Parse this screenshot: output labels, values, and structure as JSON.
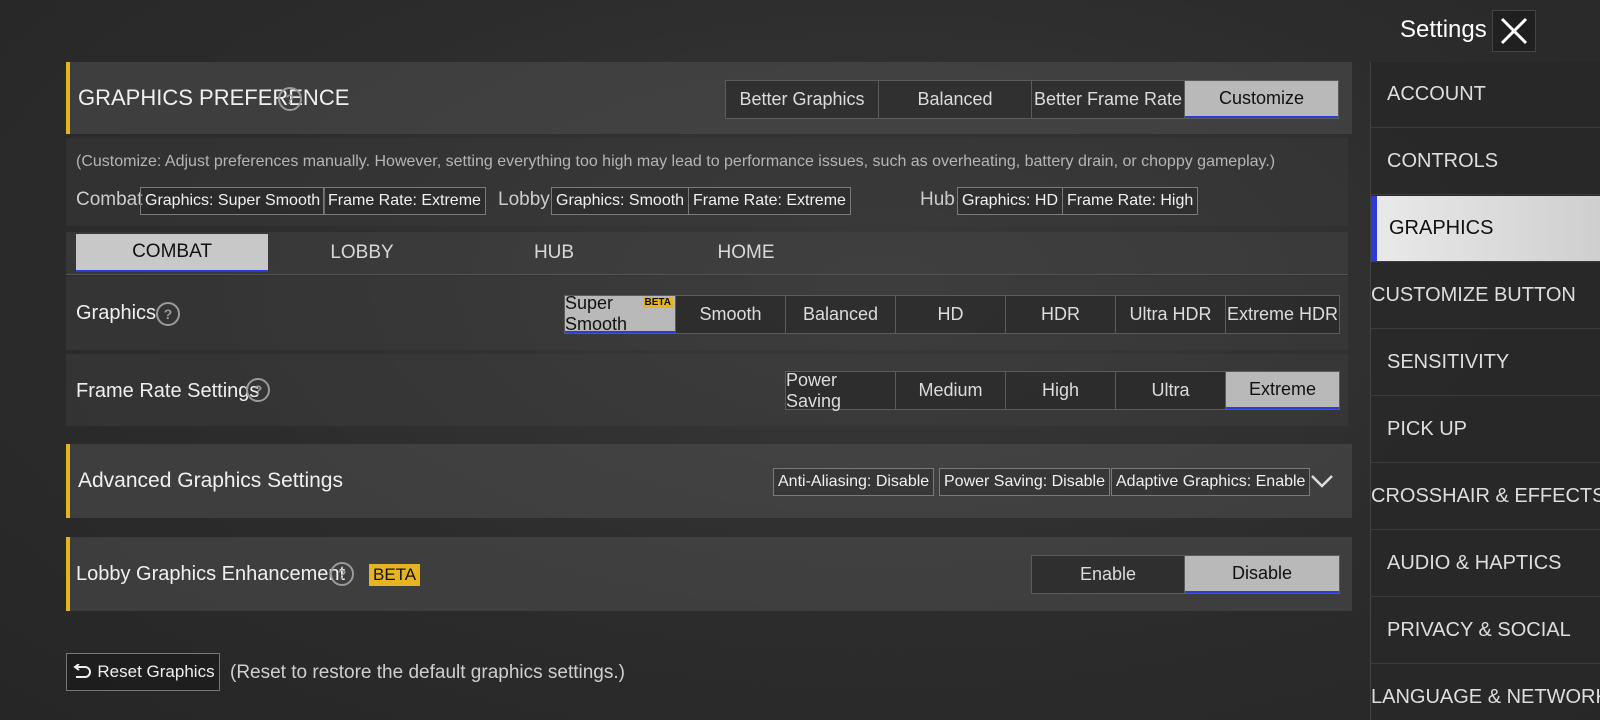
{
  "header": {
    "title": "Settings",
    "close_icon": "close-icon"
  },
  "graphics_preference": {
    "title": "GRAPHICS PREFERENCE",
    "options": [
      "Better Graphics",
      "Balanced",
      "Better Frame Rate",
      "Customize"
    ],
    "selected": "Customize"
  },
  "customize_note": "(Customize: Adjust preferences manually. However, setting everything too high may lead to performance issues, such as overheating, battery drain, or choppy gameplay.)",
  "summary": {
    "combat_label": "Combat",
    "combat_graphics": "Graphics: Super Smooth",
    "combat_framerate": "Frame Rate: Extreme",
    "lobby_label": "Lobby",
    "lobby_graphics": "Graphics: Smooth",
    "lobby_framerate": "Frame Rate: Extreme",
    "hub_label": "Hub",
    "hub_graphics": "Graphics: HD",
    "hub_framerate": "Frame Rate: High"
  },
  "tabs": [
    "COMBAT",
    "LOBBY",
    "HUB",
    "HOME"
  ],
  "selected_tab": "COMBAT",
  "graphics": {
    "label": "Graphics",
    "options": [
      "Super Smooth",
      "Smooth",
      "Balanced",
      "HD",
      "HDR",
      "Ultra HDR",
      "Extreme HDR"
    ],
    "selected": "Super Smooth",
    "beta_badge": "BETA"
  },
  "frame_rate": {
    "label": "Frame Rate Settings",
    "options": [
      "Power Saving",
      "Medium",
      "High",
      "Ultra",
      "Extreme"
    ],
    "selected": "Extreme"
  },
  "advanced": {
    "title": "Advanced Graphics Settings",
    "anti_aliasing": "Anti-Aliasing: Disable",
    "power_saving": "Power Saving: Disable",
    "adaptive": "Adaptive Graphics: Enable"
  },
  "lobby_enhancement": {
    "label": "Lobby Graphics Enhancement",
    "beta": "BETA",
    "options": [
      "Enable",
      "Disable"
    ],
    "selected": "Disable"
  },
  "reset": {
    "button_label": "Reset Graphics",
    "hint": "(Reset to restore the default graphics settings.)"
  },
  "sidebar": {
    "items": [
      "ACCOUNT",
      "CONTROLS",
      "GRAPHICS",
      "CUSTOMIZE BUTTON",
      "SENSITIVITY",
      "PICK UP",
      "CROSSHAIR & EFFECTS",
      "AUDIO & HAPTICS",
      "PRIVACY & SOCIAL",
      "LANGUAGE & NETWORK"
    ],
    "selected": "GRAPHICS"
  },
  "colors": {
    "accent": "#e6b422",
    "selected_underline": "#2a3bd8",
    "selected_bg": "#b9b9b9"
  }
}
